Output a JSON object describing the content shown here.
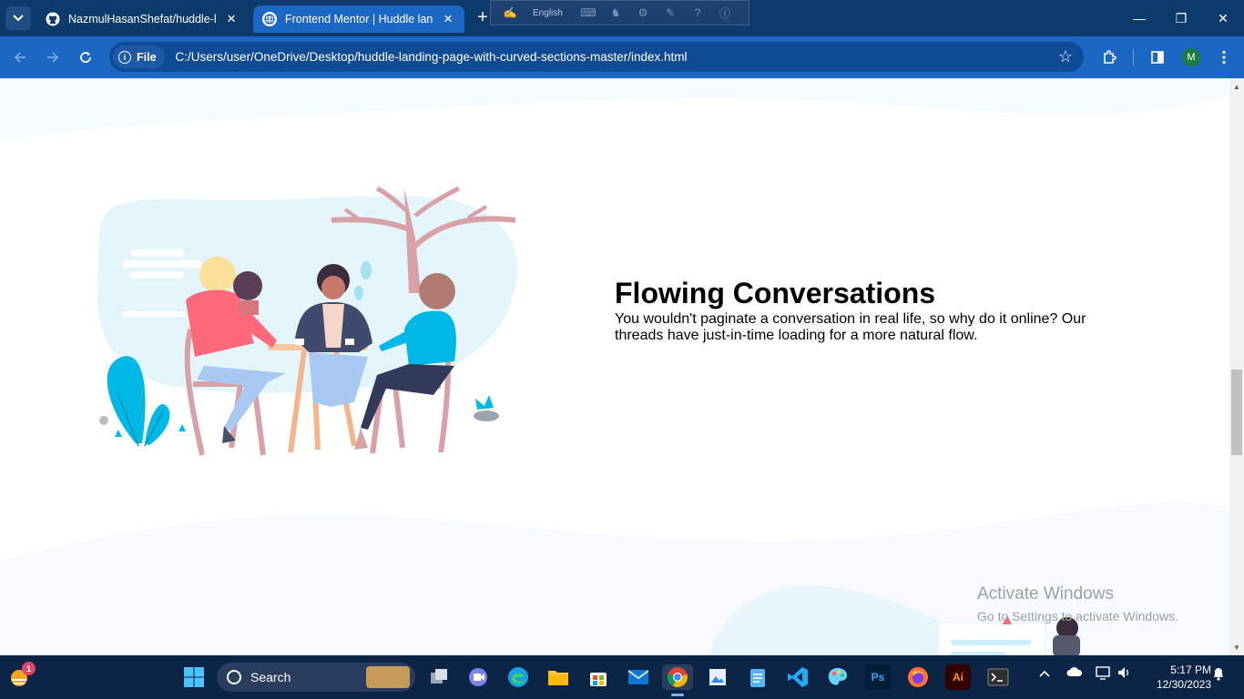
{
  "browser": {
    "tabs": [
      {
        "label": "NazmulHasanShefat/huddle-lan",
        "close": "✕"
      },
      {
        "label": "Frontend Mentor | Huddle landi",
        "close": "✕"
      }
    ],
    "new_tab": "+",
    "language_bar": {
      "label": "English"
    },
    "window_controls": {
      "minimize": "—",
      "restore": "❐",
      "close": "✕"
    },
    "address": {
      "chip_label": "File",
      "url": "C:/Users/user/OneDrive/Desktop/huddle-landing-page-with-curved-sections-master/index.html"
    },
    "profile_initial": "M"
  },
  "page": {
    "feature": {
      "title": "Flowing Conversations",
      "text": "You wouldn't paginate a conversation in real life, so why do it online? Our threads have just-in-time loading for a more natural flow."
    },
    "watermark": {
      "line1": "Activate Windows",
      "line2": "Go to Settings to activate Windows."
    }
  },
  "taskbar": {
    "search_label": "Search",
    "notification_count": "1",
    "clock": {
      "time": "5:17 PM",
      "date": "12/30/2023"
    },
    "app_labels": {
      "photoshop": "Ps",
      "illustrator": "Ai"
    }
  },
  "colors": {
    "titlebar": "#0b3a6b",
    "toolbar": "#1c66c4",
    "active_tab": "#1c66c4",
    "page_wave": "#f5fbff",
    "taskbar": "#0c2547",
    "illustration_sky": "#e4f5fc",
    "accent_cyan": "#00b8e6"
  },
  "icons": [
    "github-icon",
    "globe-icon",
    "star-icon",
    "extensions-icon",
    "sidebar-icon",
    "search-icon",
    "windows-start-icon",
    "chrome-icon",
    "edge-icon",
    "vscode-icon",
    "firefox-icon"
  ]
}
